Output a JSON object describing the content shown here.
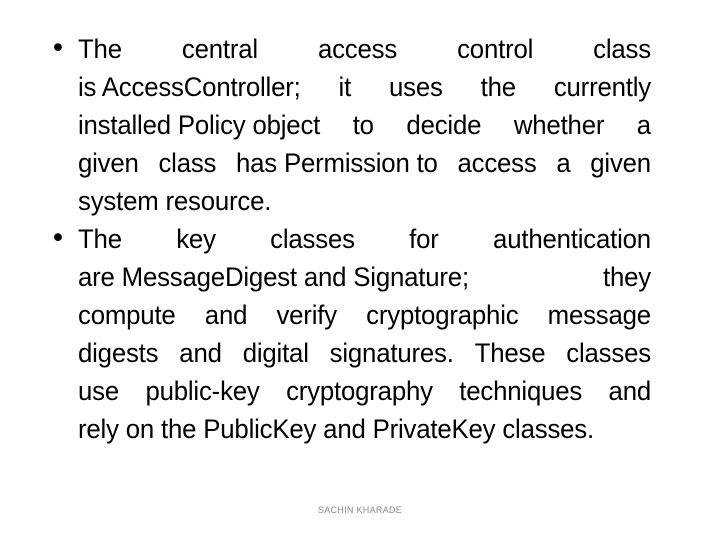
{
  "slide": {
    "background_color": "#ffffff",
    "text_color": "#000000",
    "bullet_glyph": "•",
    "bullets": [
      {
        "id": "bullet-access-control",
        "full_text": "The central access control class is AccessController; it uses the currently installed Policy object to decide whether a given class has Permission to access a given system resource.",
        "lines": [
          {
            "justified": true,
            "words": [
              "The",
              "central",
              "access",
              "control",
              "class"
            ]
          },
          {
            "justified": true,
            "words": [
              "is AccessController;",
              "it",
              "uses",
              "the",
              "currently"
            ]
          },
          {
            "justified": true,
            "words": [
              "installed Policy object",
              "to",
              "decide",
              "whether",
              "a"
            ]
          },
          {
            "justified": true,
            "words": [
              "given",
              "class",
              "has Permission to",
              "access",
              "a",
              "given"
            ]
          },
          {
            "justified": false,
            "text": "system resource."
          }
        ]
      },
      {
        "id": "bullet-authentication",
        "full_text": "The key classes for authentication are MessageDigest and Signature; they compute and verify cryptographic message digests and digital signatures. These classes use public-key cryptography techniques and rely on the PublicKey and PrivateKey classes.",
        "lines": [
          {
            "justified": true,
            "words": [
              "The",
              "key",
              "classes",
              "for",
              "authentication"
            ]
          },
          {
            "justified": true,
            "words": [
              "are MessageDigest and Signature;",
              "they"
            ]
          },
          {
            "justified": true,
            "words": [
              "compute",
              "and",
              "verify",
              "cryptographic",
              "message"
            ]
          },
          {
            "justified": true,
            "words": [
              "digests",
              "and",
              "digital",
              "signatures.",
              "These",
              "classes"
            ]
          },
          {
            "justified": true,
            "words": [
              "use",
              "public-key",
              "cryptography",
              "techniques",
              "and"
            ]
          },
          {
            "justified": false,
            "text": "rely on the PublicKey and PrivateKey classes."
          }
        ]
      }
    ]
  },
  "footer": {
    "credit": "SACHIN KHARADE",
    "color": "#8a8a8a"
  }
}
